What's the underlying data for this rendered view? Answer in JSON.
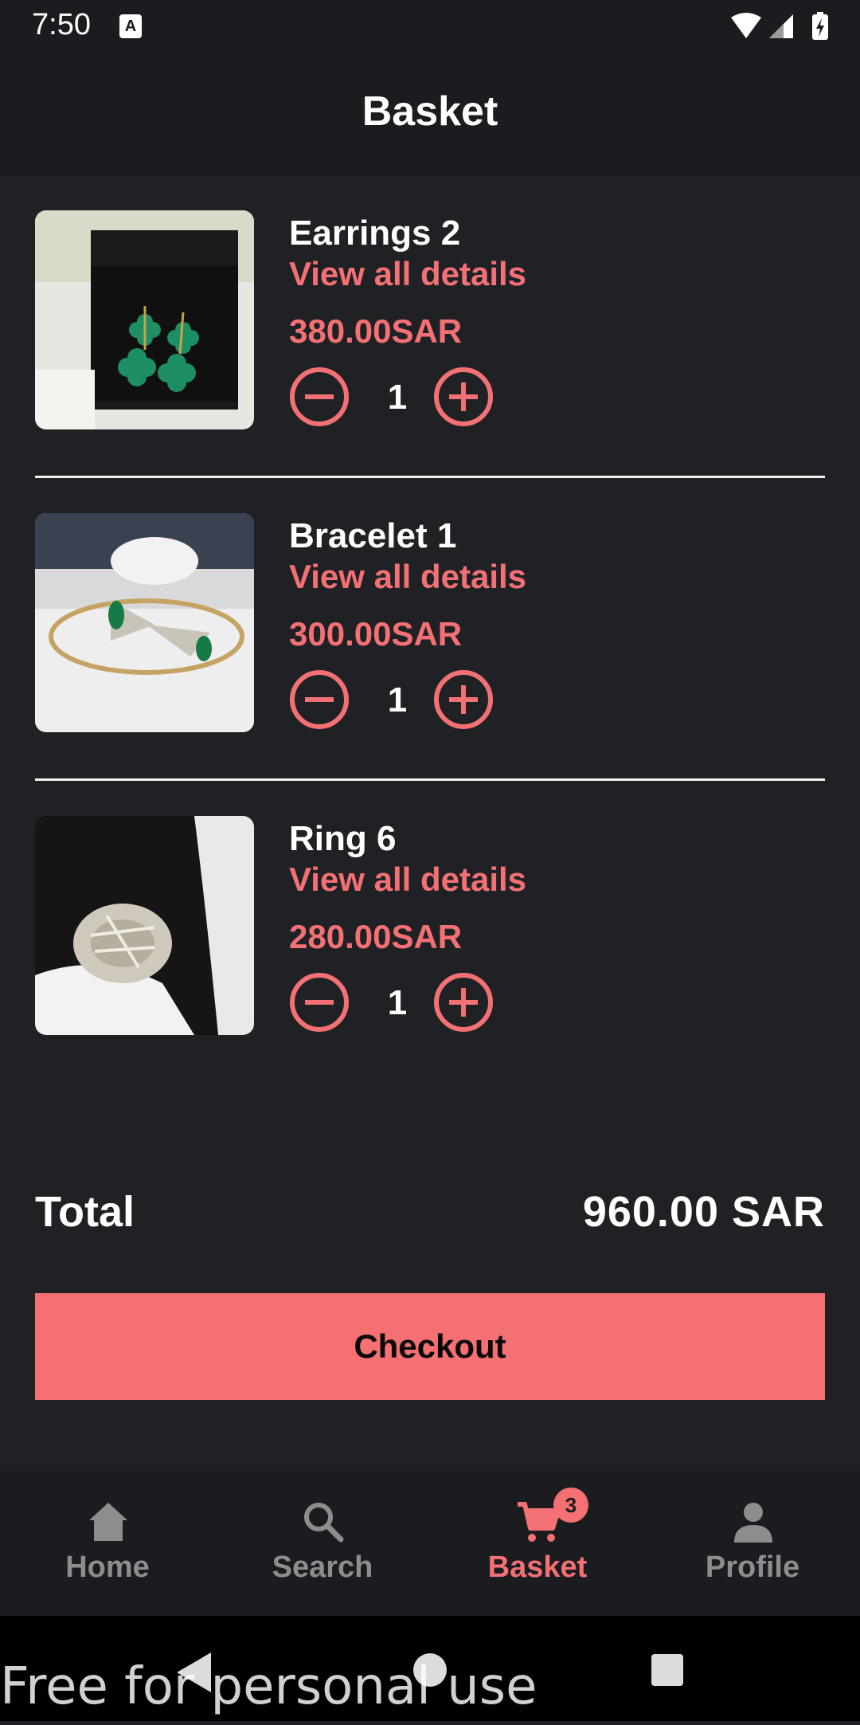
{
  "status_bar": {
    "time": "7:50",
    "notification_icon_label": "A",
    "icons": [
      "wifi-icon",
      "signal-icon",
      "battery-icon"
    ]
  },
  "app_bar": {
    "title": "Basket"
  },
  "items": [
    {
      "name": "Earrings 2",
      "details_link": "View all details",
      "price": "380.00SAR",
      "quantity": "1",
      "photo": "green clover earrings in box"
    },
    {
      "name": "Bracelet 1",
      "details_link": "View all details",
      "price": "300.00SAR",
      "quantity": "1",
      "photo": "gold bracelet with green stones"
    },
    {
      "name": "Ring 6",
      "details_link": "View all details",
      "price": "280.00SAR",
      "quantity": "1",
      "photo": "diamond serpent ring"
    }
  ],
  "summary": {
    "total_label": "Total",
    "total_value": "960.00 SAR"
  },
  "checkout": {
    "label": "Checkout"
  },
  "bottom_nav": {
    "items": [
      {
        "label": "Home",
        "icon": "home-icon",
        "active": false
      },
      {
        "label": "Search",
        "icon": "search-icon",
        "active": false
      },
      {
        "label": "Basket",
        "icon": "cart-icon",
        "active": true,
        "badge": "3"
      },
      {
        "label": "Profile",
        "icon": "person-icon",
        "active": false
      }
    ]
  },
  "watermark": "Free for personal use",
  "colors": {
    "accent": "#f37174",
    "background": "#202125",
    "bar": "#1b1c20"
  }
}
